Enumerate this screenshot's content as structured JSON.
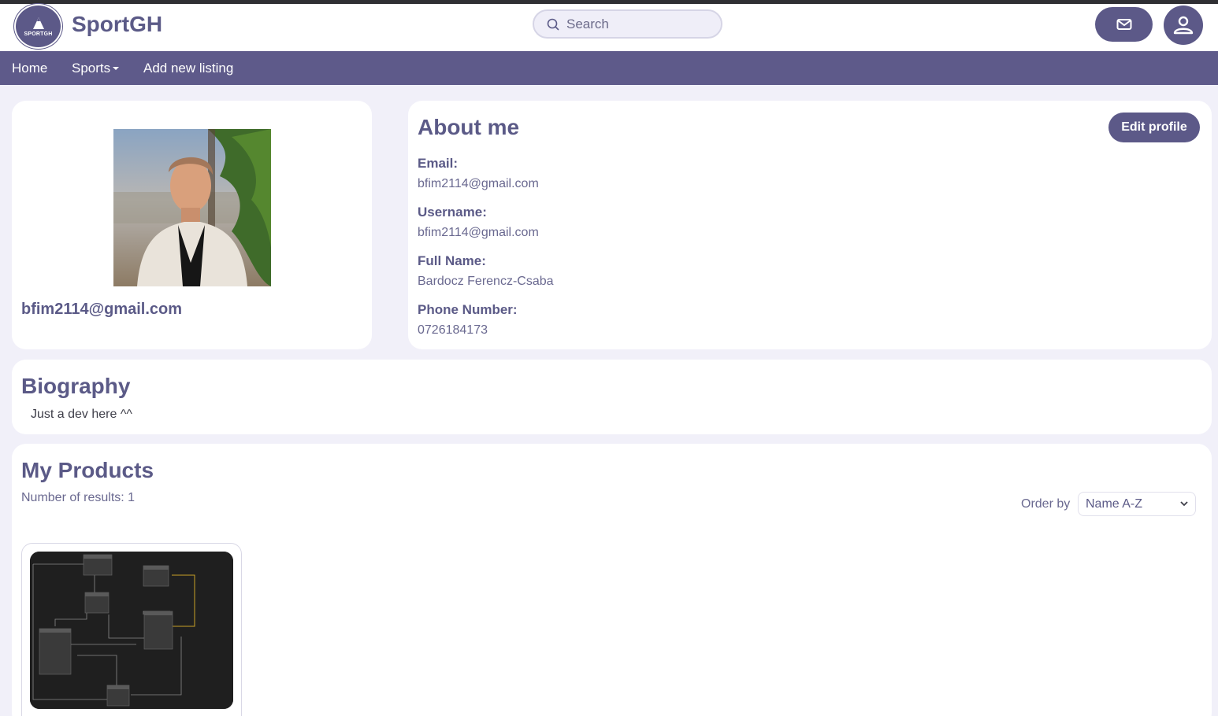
{
  "header": {
    "logo_text": "SPORTGH",
    "brand": "SportGH",
    "search_placeholder": "Search"
  },
  "nav": {
    "home": "Home",
    "sports": "Sports",
    "add_listing": "Add new listing"
  },
  "profile": {
    "name": "bfim2114@gmail.com"
  },
  "about": {
    "title": "About me",
    "edit_label": "Edit profile",
    "email_label": "Email:",
    "email_value": "bfim2114@gmail.com",
    "username_label": "Username:",
    "username_value": "bfim2114@gmail.com",
    "fullname_label": "Full Name:",
    "fullname_value": "Bardocz Ferencz-Csaba",
    "phone_label": "Phone Number:",
    "phone_value": "0726184173"
  },
  "biography": {
    "title": "Biography",
    "text": "Just a dev here ^^"
  },
  "products": {
    "title": "My Products",
    "results": "Number of results: 1",
    "order_label": "Order by",
    "order_value": "Name A-Z"
  },
  "colors": {
    "accent": "#5c5988",
    "background": "#f1f0f9"
  }
}
